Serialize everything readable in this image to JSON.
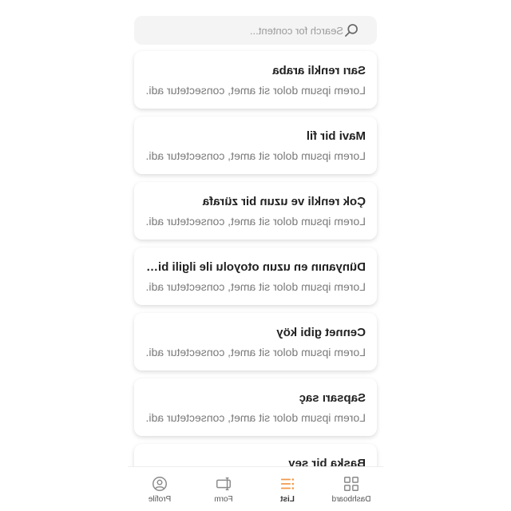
{
  "search": {
    "placeholder": "Search for content..."
  },
  "list": {
    "items": [
      {
        "title": "Sarı renkli araba",
        "subtitle": "Lorem ipsum dolor sit amet, consectetur adi..."
      },
      {
        "title": "Mavi bir fil",
        "subtitle": "Lorem ipsum dolor sit amet, consectetur adi..."
      },
      {
        "title": "Çok renkli ve uzun bir zürafa",
        "subtitle": "Lorem ipsum dolor sit amet, consectetur adi..."
      },
      {
        "title": "Dünyanın en uzun otoyolu ile ilgili bir...",
        "subtitle": "Lorem ipsum dolor sit amet, consectetur adi..."
      },
      {
        "title": "Cennet gibi köy",
        "subtitle": "Lorem ipsum dolor sit amet, consectetur adi..."
      },
      {
        "title": "Sapsarı saç",
        "subtitle": "Lorem ipsum dolor sit amet, consectetur adi..."
      },
      {
        "title": "Başka bir şey",
        "subtitle": ""
      }
    ]
  },
  "tabbar": {
    "tabs": [
      {
        "label": "Dashboard",
        "icon": "grid-icon"
      },
      {
        "label": "List",
        "icon": "list-icon"
      },
      {
        "label": "Form",
        "icon": "form-icon"
      },
      {
        "label": "Profile",
        "icon": "profile-icon"
      }
    ],
    "active_index": 1
  },
  "colors": {
    "accent": "#f2994a",
    "icon_gray": "#8a8a8a",
    "title": "#222222",
    "subtitle": "#7a7a7a"
  }
}
